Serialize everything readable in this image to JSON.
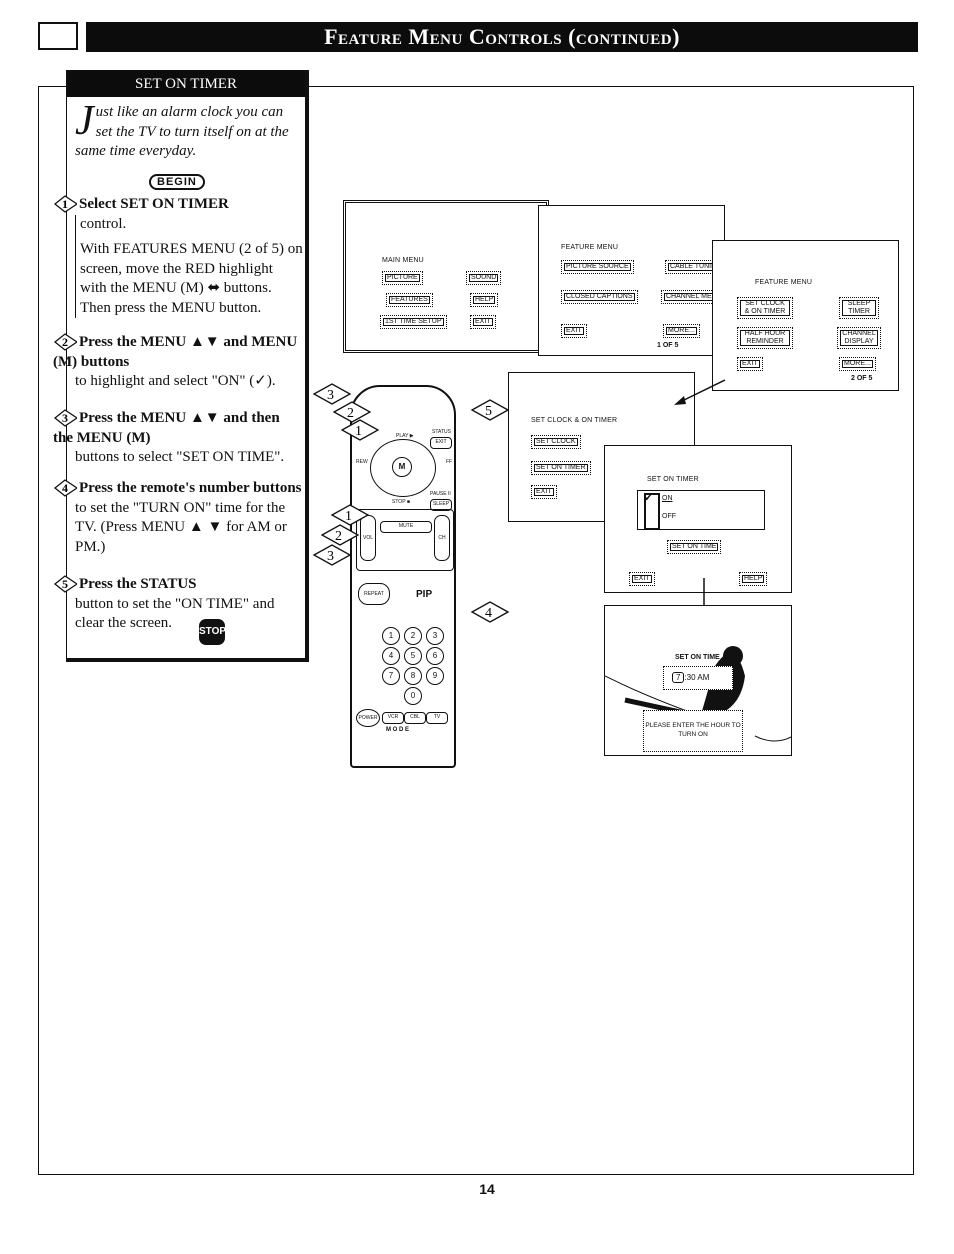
{
  "header": {
    "title": "Feature Menu Controls (continued)"
  },
  "sidebar": {
    "title": "SET ON TIMER",
    "intro_dropcap": "J",
    "intro_rest": "ust like an alarm clock you can set the TV to turn itself on at the same time everyday.",
    "begin_label": "BEGIN",
    "steps": [
      {
        "num": "1",
        "head": "Select SET ON TIMER",
        "body": "control.",
        "body2": "With FEATURES MENU (2 of 5) on screen, move the RED highlight with the MENU (M) ⬌ buttons. Then press the MENU button."
      },
      {
        "num": "2",
        "head": "Press the MENU ▲▼ and MENU (M) buttons",
        "body": "to highlight and select \"ON\" (✓)."
      },
      {
        "num": "3",
        "head": "Press the MENU ▲▼ and then the MENU (M)",
        "body": "buttons to select \"SET ON TIME\"."
      },
      {
        "num": "4",
        "head": "Press the remote's number buttons",
        "body": "to set the \"TURN ON\" time for the TV. (Press MENU ▲ ▼ for AM or PM.)"
      },
      {
        "num": "5",
        "head": "Press the STATUS",
        "body": "button to set the \"ON TIME\" and clear the screen."
      }
    ],
    "stop_label": "STOP"
  },
  "screens": {
    "main_menu": {
      "title": "MAIN MENU",
      "buttons": [
        "PICTURE",
        "SOUND",
        "FEATURES",
        "HELP",
        "1ST TIME SETUP",
        "EXIT"
      ]
    },
    "feature_menu_1": {
      "title": "FEATURE MENU",
      "buttons": [
        "PICTURE SOURCE",
        "CABLE TUNING",
        "CLOSED CAPTIONS",
        "CHANNEL MEMORY",
        "EXIT",
        "MORE..."
      ],
      "page": "1 OF 5"
    },
    "feature_menu_2": {
      "title": "FEATURE MENU",
      "buttons": [
        "SET CLOCK & ON TIMER",
        "SLEEP TIMER",
        "HALF HOUR REMINDER",
        "CHANNEL DISPLAY",
        "EXIT",
        "MORE..."
      ],
      "page": "2 OF 5"
    },
    "set_clock": {
      "title": "SET CLOCK & ON TIMER",
      "buttons": [
        "SET CLOCK",
        "SET ON TIMER",
        "EXIT"
      ]
    },
    "set_on_timer": {
      "title": "SET ON TIMER",
      "options": [
        "ON",
        "OFF"
      ],
      "selected": "ON",
      "buttons": [
        "SET ON TIME",
        "EXIT",
        "HELP"
      ]
    },
    "set_on_time": {
      "title": "SET ON TIME",
      "hour": "7",
      "rest": ":30 AM",
      "prompt": "PLEASE ENTER THE HOUR TO TURN ON"
    }
  },
  "remote": {
    "labels": [
      "PLAY ▶",
      "STATUS",
      "EXIT",
      "REW",
      "FF",
      "MENU",
      "M",
      "PAUSE II",
      "STOP ■",
      "SLEEP",
      "VOL",
      "MUTE",
      "CH",
      "REPEAT",
      "PIP",
      "POWER",
      "VCR",
      "CBL",
      "TV",
      "M O D E"
    ],
    "numbers": [
      "1",
      "2",
      "3",
      "4",
      "5",
      "6",
      "7",
      "8",
      "9",
      "0"
    ],
    "callouts": [
      "3",
      "2",
      "1",
      "5",
      "1",
      "2",
      "3",
      "4"
    ]
  },
  "footer": {
    "page_number": "14"
  }
}
